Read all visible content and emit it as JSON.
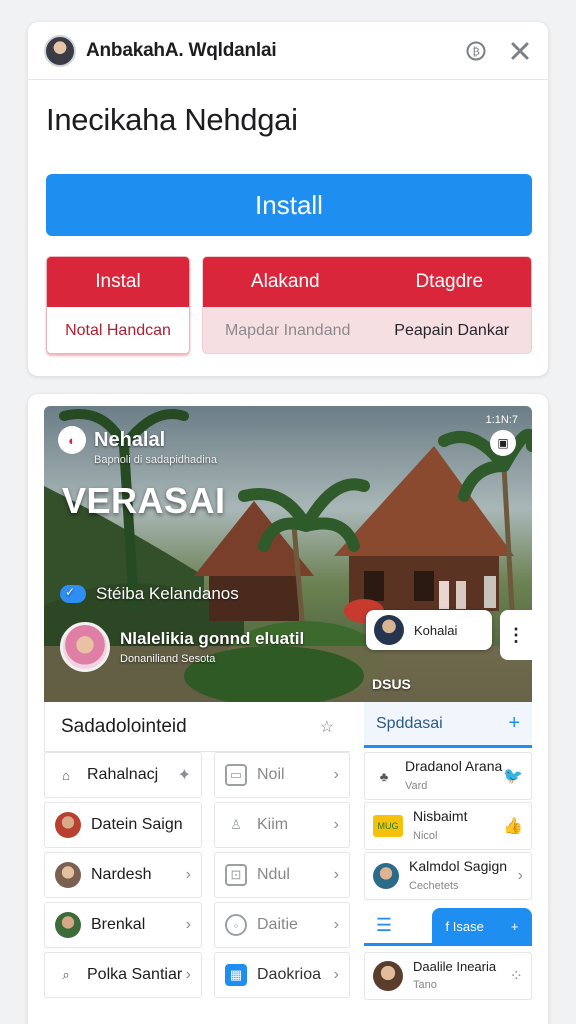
{
  "header": {
    "account_name": "AnbakahA. Wqldanlai",
    "icons": [
      "currency-icon",
      "tools-icon"
    ]
  },
  "page_title": "Inecikaha Nehdgai",
  "install_button": "Install",
  "options": {
    "first": {
      "top": "Instal",
      "bottom": "Notal Handcan"
    },
    "second": {
      "top_left": "Alakand",
      "top_right": "Dtagdre",
      "bottom_left": "Mapdar Inandand",
      "bottom_right": "Peapain Dankar"
    }
  },
  "hero": {
    "brand": "Nehalal",
    "subtitle": "Bapnoli di sadapidhadina",
    "headline": "VERASAI",
    "time": "1:1N:7",
    "verified_label": "Stéiba Kelandanos",
    "person_name": "Nlalelikia gonnd eluatil",
    "person_sub": "Donaniliand Sesota",
    "chip_label": "Kohalai",
    "tag": "DSUS"
  },
  "left_section": {
    "title": "Sadadolointeid",
    "items": [
      {
        "label": "Rahalnacj",
        "icon": "home-icon"
      },
      {
        "label": "Datein Saign",
        "icon": "user-photo"
      },
      {
        "label": "Nardesh",
        "icon": "user-photo"
      },
      {
        "label": "Brenkal",
        "icon": "user-photo"
      },
      {
        "label": "Polka Santiar",
        "icon": "search-icon"
      }
    ]
  },
  "middle_section": {
    "items": [
      {
        "label": "Noil",
        "icon": "image-icon"
      },
      {
        "label": "Kiim",
        "icon": "person-icon"
      },
      {
        "label": "Ndul",
        "icon": "tag-icon"
      },
      {
        "label": "Daitie",
        "icon": "clock-icon"
      },
      {
        "label": "Daokrioa",
        "icon": "calendar-icon"
      }
    ]
  },
  "right_section": {
    "title": "Spddasai",
    "items": [
      {
        "title": "Dradanol Arana",
        "sub": "Vard",
        "icon": "tree-icon",
        "action": "twitter-icon"
      },
      {
        "title": "Nisbaimt",
        "sub": "Nicol",
        "icon": "mug-badge",
        "action": "thumbs-up-icon"
      },
      {
        "title": "Kalmdol Sagign",
        "sub": "Cechetets",
        "icon": "user-photo",
        "action": "chevron"
      }
    ],
    "fb_button": "f  Isase",
    "bottom_item": {
      "title": "Daalile Inearia",
      "sub": "Tano",
      "icon": "user-photo"
    }
  },
  "colors": {
    "accent": "#1e8ff0",
    "danger": "#d9263a"
  }
}
